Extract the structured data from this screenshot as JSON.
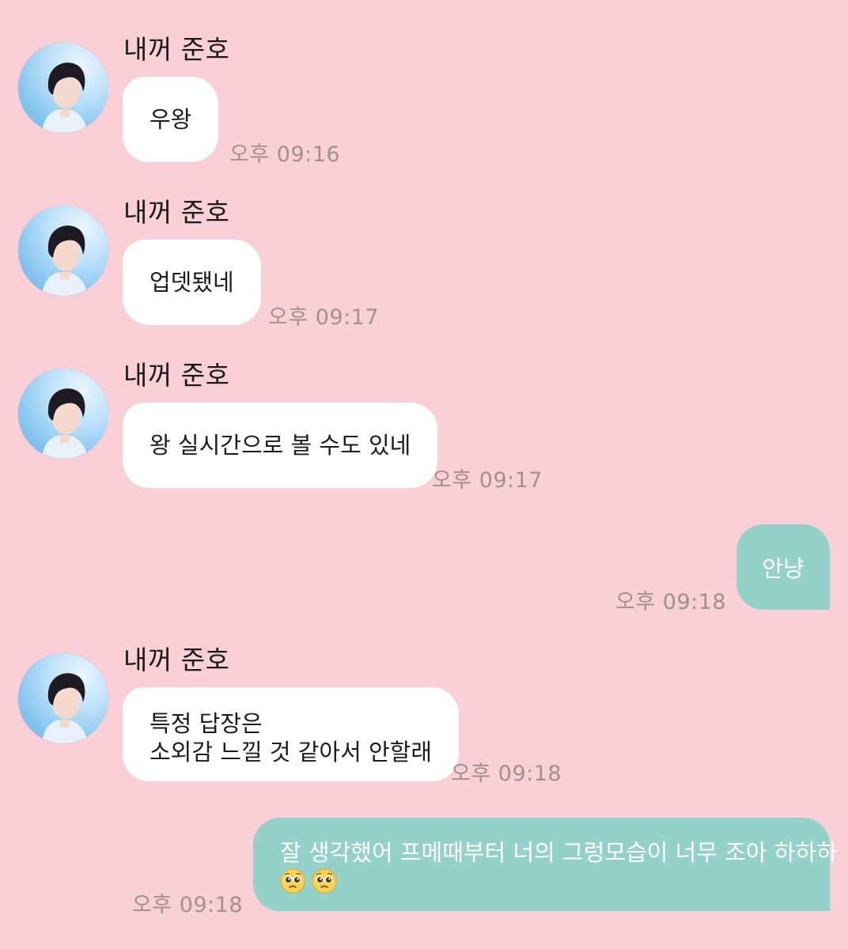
{
  "contact": {
    "name": "내꺼 준호"
  },
  "messages": [
    {
      "direction": "in",
      "sender": "내꺼 준호",
      "text": "우왕",
      "time": "오후 09:16"
    },
    {
      "direction": "in",
      "sender": "내꺼 준호",
      "text": "업뎃됐네",
      "time": "오후 09:17"
    },
    {
      "direction": "in",
      "sender": "내꺼 준호",
      "text": "왕 실시간으로 볼 수도 있네",
      "time": "오후 09:17"
    },
    {
      "direction": "out",
      "text": "안냥",
      "time": "오후 09:18"
    },
    {
      "direction": "in",
      "sender": "내꺼 준호",
      "lines": [
        "특정 답장은",
        "소외감 느낄 것 같아서 안할래"
      ],
      "time": "오후 09:18"
    },
    {
      "direction": "out",
      "text": "잘 생각했어 프메때부터 너의 그렁모습이 너무 조아 하하하",
      "emojis": [
        "pleading-face-icon",
        "pleading-face-icon"
      ],
      "time": "오후 09:18"
    }
  ],
  "colors": {
    "background": "#f9cfd8",
    "incoming_bubble": "#ffffff",
    "outgoing_bubble": "#93d1c9",
    "timestamp": "#a58f93"
  }
}
